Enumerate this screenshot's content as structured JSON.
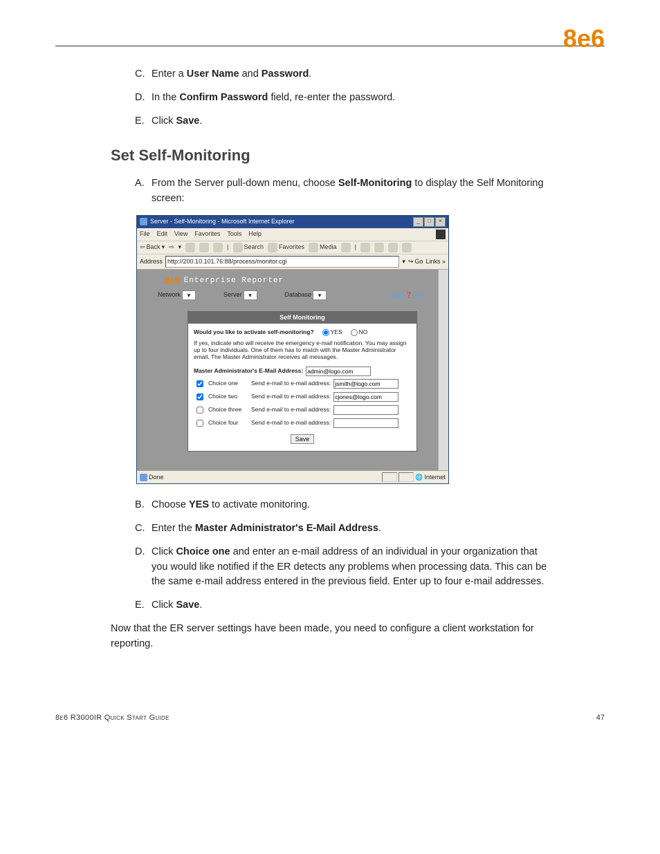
{
  "header": {
    "logo": "8e6"
  },
  "steps_top": {
    "c": {
      "letter": "C.",
      "prefix": "Enter a ",
      "b1": "User Name",
      "mid": " and ",
      "b2": "Password",
      "suffix": "."
    },
    "d": {
      "letter": "D.",
      "prefix": "In the ",
      "b1": "Confirm Password",
      "suffix": " field, re-enter the password."
    },
    "e": {
      "letter": "E.",
      "prefix": "Click ",
      "b1": "Save",
      "suffix": "."
    }
  },
  "heading": "Set Self-Monitoring",
  "step_a": {
    "letter": "A.",
    "prefix": "From the Server pull-down menu, choose ",
    "b1": "Self-Monitoring",
    "suffix": " to display the Self Monitoring screen:"
  },
  "screenshot": {
    "title": "Server - Self-Monitoring - Microsoft Internet Explorer",
    "menus": {
      "file": "File",
      "edit": "Edit",
      "view": "View",
      "favorites": "Favorites",
      "tools": "Tools",
      "help": "Help"
    },
    "toolbar": {
      "back": "Back",
      "search": "Search",
      "favorites": "Favorites",
      "media": "Media"
    },
    "address": {
      "label": "Address",
      "url": "http://200.10.101.76:88/process/monitor.cgi",
      "go": "Go",
      "links": "Links »"
    },
    "brand": {
      "logo": "8e6",
      "title": "Enterprise Reporter"
    },
    "nav": {
      "network": "Network",
      "server": "Server",
      "database": "Database",
      "logout": "Logout",
      "help": "Help"
    },
    "panel": {
      "title": "Self Monitoring",
      "activate_q": "Would you like to activate self-monitoring?",
      "yes": "YES",
      "no": "NO",
      "note": "If yes, indicate who will receive the emergency e-mail notification. You may assign up to four individuals. One of them has to match with the Master Administrator email. The Master Administrator receives all messages.",
      "master_label": "Master Administrator's E-Mail Address:",
      "master_value": "admin@logo.com",
      "send_label": "Send e-mail to e-mail address:",
      "choices": {
        "one": {
          "label": "Choice one",
          "value": "jsmith@logo.com",
          "checked": true
        },
        "two": {
          "label": "Choice two",
          "value": "cjones@logo.com",
          "checked": true
        },
        "three": {
          "label": "Choice three",
          "value": "",
          "checked": false
        },
        "four": {
          "label": "Choice four",
          "value": "",
          "checked": false
        }
      },
      "save": "Save"
    },
    "status": {
      "done": "Done",
      "zone": "Internet"
    }
  },
  "steps_bottom": {
    "b": {
      "letter": "B.",
      "prefix": "Choose ",
      "b1": "YES",
      "suffix": " to activate monitoring."
    },
    "c": {
      "letter": "C.",
      "prefix": "Enter the ",
      "b1": "Master Administrator's E-Mail Address",
      "suffix": "."
    },
    "d": {
      "letter": "D.",
      "prefix": "Click ",
      "b1": "Choice one",
      "suffix": " and enter an e-mail address of an individual in your organization that you would like notified if the ER detects any problems when processing data. This can be the same e-mail address entered in the previous field. Enter up to four e-mail addresses."
    },
    "e": {
      "letter": "E.",
      "prefix": "Click ",
      "b1": "Save",
      "suffix": "."
    }
  },
  "closing": "Now that the ER server settings have been made, you need to configure a client workstation for reporting.",
  "footer": {
    "guide": "8e6 R3000IR Quick Start Guide",
    "page": "47"
  }
}
